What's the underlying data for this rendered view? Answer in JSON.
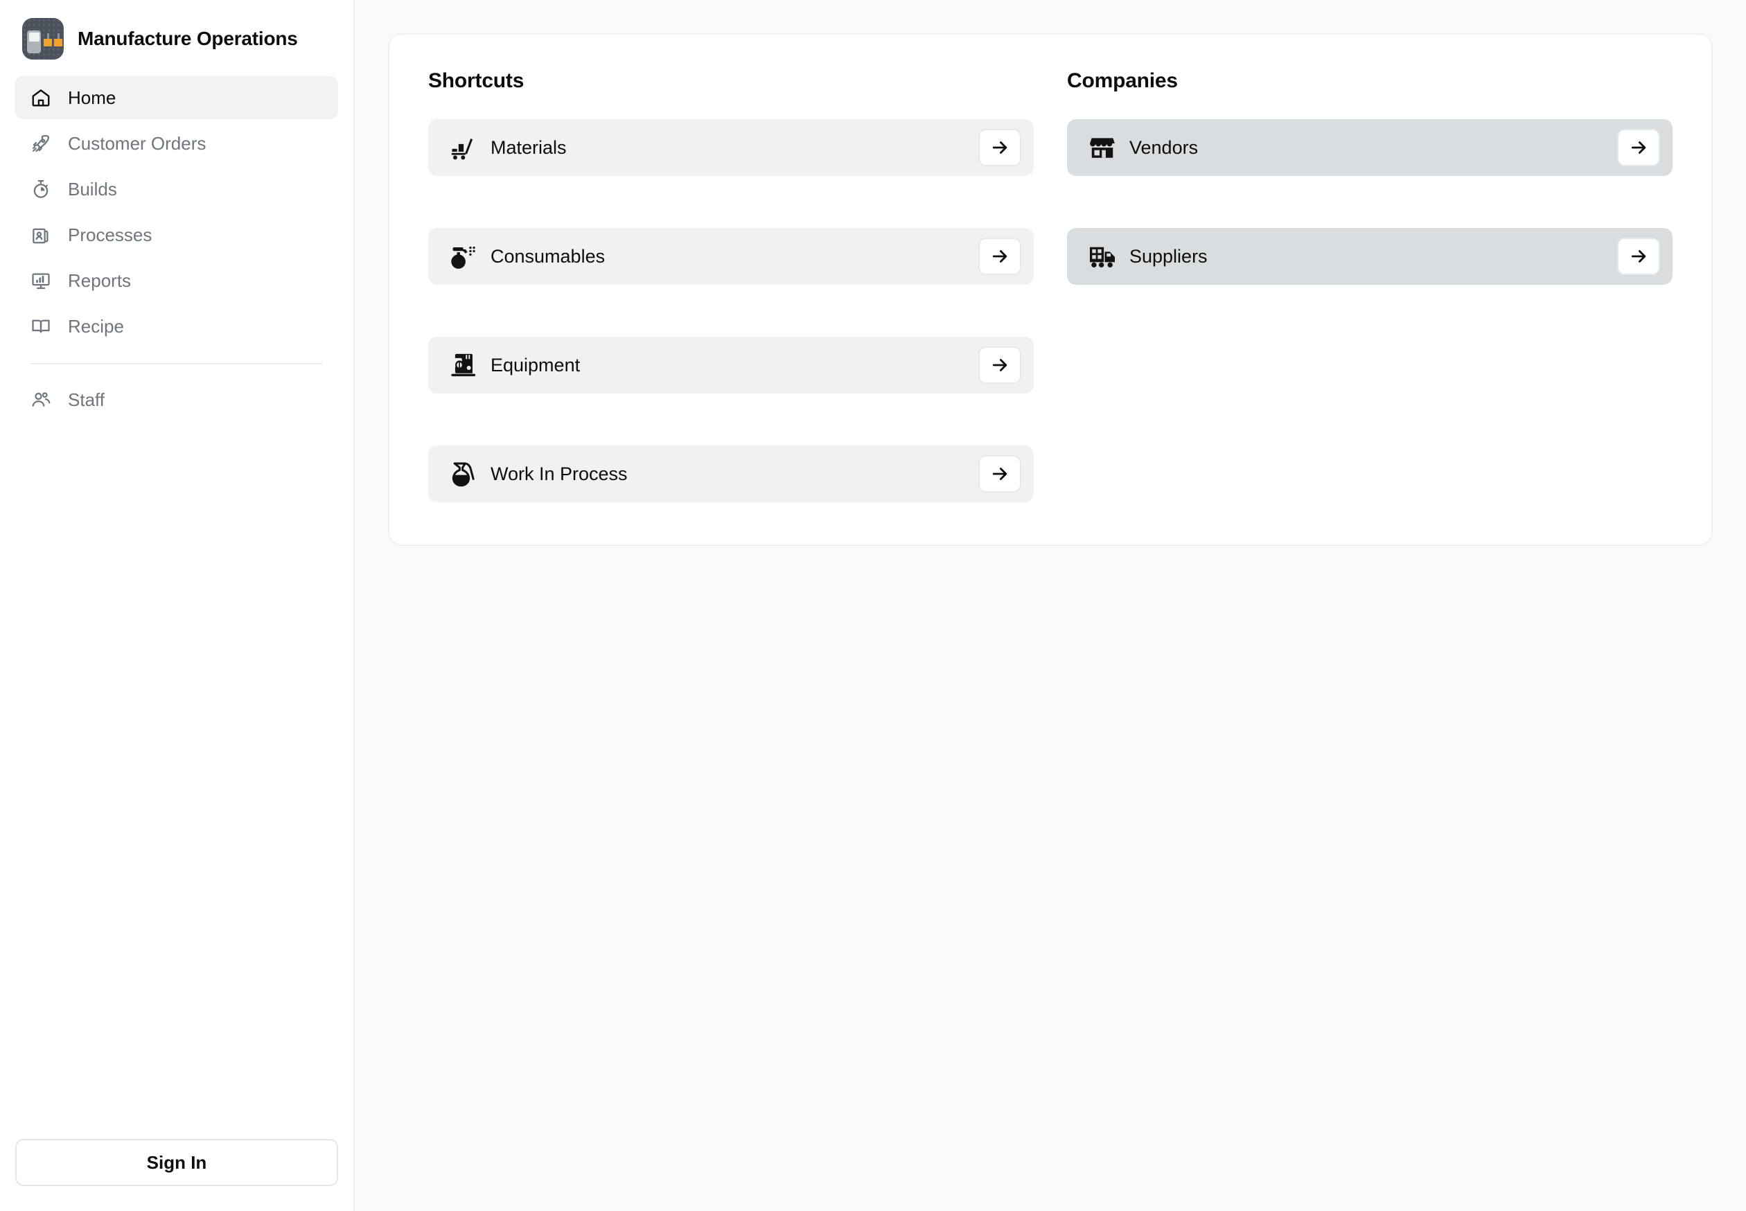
{
  "sidebar": {
    "brand": {
      "title": "Manufacture Operations",
      "logo_icon": "factory-app-logo",
      "logo_colors": {
        "base": "#4b525c",
        "accent": "#f0a32c",
        "panel": "#aeb3ba"
      }
    },
    "items": [
      {
        "label": "Home",
        "icon": "home-icon",
        "active": true
      },
      {
        "label": "Customer Orders",
        "icon": "rocket-icon",
        "active": false
      },
      {
        "label": "Builds",
        "icon": "stopwatch-icon",
        "active": false
      },
      {
        "label": "Processes",
        "icon": "id-card-icon",
        "active": false
      },
      {
        "label": "Reports",
        "icon": "monitor-chart-icon",
        "active": false
      },
      {
        "label": "Recipe",
        "icon": "open-book-icon",
        "active": false
      },
      {
        "label": "Staff",
        "icon": "users-icon",
        "active": false
      }
    ],
    "divider_before_index": 6,
    "sign_in_label": "Sign In"
  },
  "main": {
    "shortcuts": {
      "title": "Shortcuts",
      "items": [
        {
          "label": "Materials",
          "icon": "hand-truck-icon",
          "arrow": "arrow-right-icon"
        },
        {
          "label": "Consumables",
          "icon": "spray-bottle-icon",
          "arrow": "arrow-right-icon"
        },
        {
          "label": "Equipment",
          "icon": "stand-mixer-icon",
          "arrow": "arrow-right-icon"
        },
        {
          "label": "Work In Process",
          "icon": "pitcher-icon",
          "arrow": "arrow-right-icon"
        }
      ]
    },
    "companies": {
      "title": "Companies",
      "items": [
        {
          "label": "Vendors",
          "icon": "storefront-icon",
          "arrow": "arrow-right-icon"
        },
        {
          "label": "Suppliers",
          "icon": "delivery-truck-icon",
          "arrow": "arrow-right-icon"
        }
      ]
    }
  },
  "colors": {
    "page_background": "#f8f9f9",
    "card_background": "#ffffff",
    "shortcut_row": "#f0f1f1",
    "company_row": "#d9dde0",
    "active_nav": "#f1f2f2",
    "text_primary": "#0b0d0e",
    "text_muted": "#6e757d"
  }
}
